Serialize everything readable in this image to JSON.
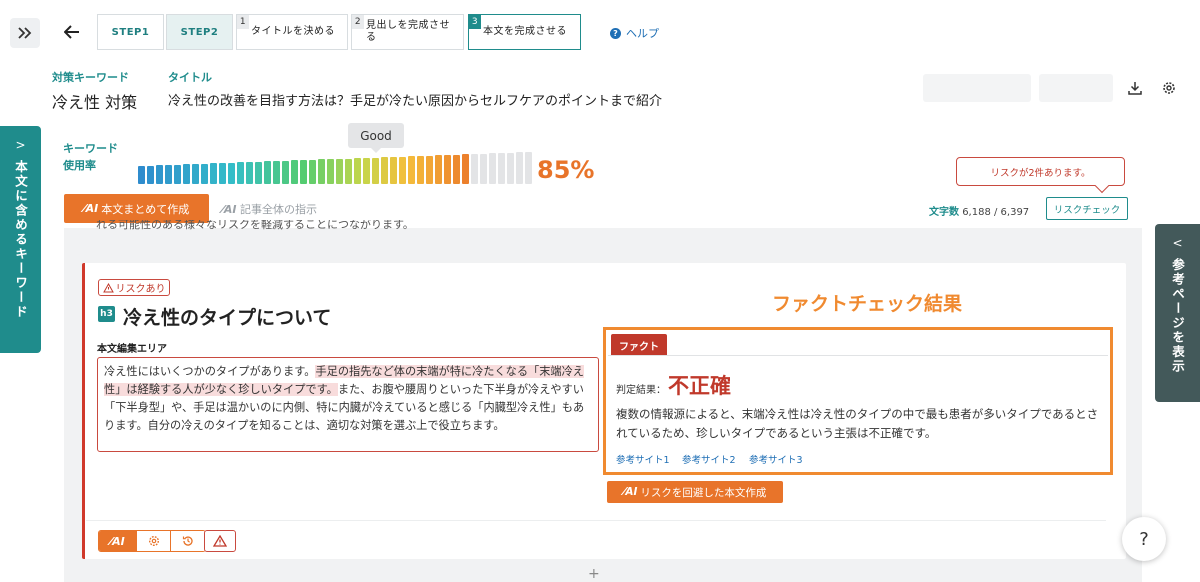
{
  "steps": [
    {
      "label": "STEP1"
    },
    {
      "label": "STEP2"
    },
    {
      "num": "1",
      "label": "タイトルを決める"
    },
    {
      "num": "2",
      "label": "見出しを完成させる"
    },
    {
      "num": "3",
      "label": "本文を完成させる"
    }
  ],
  "help_label": "ヘルプ",
  "keyword": {
    "label": "対策キーワード",
    "value": "冷え性 対策"
  },
  "title": {
    "label": "タイトル",
    "value": "冷え性の改善を目指す方法は？手足が冷たい原因からセルフケアのポイントまで紹介"
  },
  "left_tab_label": "本文に含めるキーワード",
  "right_tab_label": "参考ページを表示",
  "usage": {
    "label_line1": "キーワード",
    "label_line2": "使用率",
    "tooltip": "Good",
    "percent": "85%",
    "fill_fraction": 0.85
  },
  "risk_note": "リスクが2件あります。",
  "wordcount": {
    "label": "文字数",
    "value": "6,188 / 6,397"
  },
  "riskcheck_label": "リスクチェック",
  "ai_main_label": "本文まとめて作成",
  "ai_instruction_label": "記事全体の指示",
  "ai_mark": "⁄AI",
  "faded_text": "れる可能性のある様々なリスクを軽減することにつながります。",
  "section": {
    "risk_badge": "リスクあり",
    "heading_tag": "h3",
    "heading": "冷え性のタイプについて",
    "area_label": "本文編集エリア",
    "body": {
      "p1": "冷え性にはいくつかのタイプがあります。",
      "p2": "手足の指先など体の末端が特に冷たくなる「末端冷え性」は経験する人が少なく珍しいタイプです。",
      "p3": "また、お腹や腰周りといった下半身が冷えやすい「下半身型」や、手足は温かいのに内側、特に内臓が冷えていると感じる「内臓型冷え性」もあります。自分の冷えのタイプを知ることは、適切な対策を選ぶ上で役立ちます。"
    }
  },
  "factcheck": {
    "heading": "ファクトチェック結果",
    "tag": "ファクト",
    "verdict_label": "判定結果：",
    "verdict": "不正確",
    "text": "複数の情報源によると、末端冷え性は冷え性のタイプの中で最も患者が多いタイプであるとされているため、珍しいタイプであるという主張は不正確です。",
    "refs": [
      "参考サイト1",
      "参考サイト2",
      "参考サイト3"
    ],
    "ai_button": "リスクを回避した本文作成"
  },
  "colors": {
    "accent": "#1f8c8c",
    "orange": "#e8742a",
    "risk": "#c0392b",
    "factcheck_border": "#f08a30"
  },
  "fab_label": "?"
}
